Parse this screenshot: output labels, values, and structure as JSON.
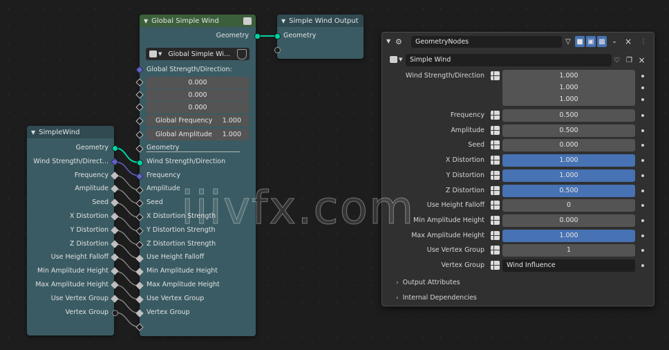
{
  "nodes": {
    "global_simple_wind": {
      "title": "Global Simple Wind",
      "output_geometry": "Geometry",
      "group_selector": "Global Simple Wi...",
      "strength_label": "Global Strength/Direction:",
      "strength_values": [
        "0.000",
        "0.000",
        "0.000"
      ],
      "frequency_label": "Global Frequency",
      "frequency_value": "1.000",
      "amplitude_label": "Global Amplitude",
      "amplitude_value": "1.000",
      "inputs": [
        "Geometry",
        "Wind Strength/Direction",
        "Frequency",
        "Amplitude",
        "Seed",
        "X Distortion Strength",
        "Y Distortion Strength",
        "Z Distortion Strength",
        "Use Height Falloff",
        "Min Amplitude Height",
        "Max Amplitude Height",
        "Use Vertex Group",
        "Vertex Group"
      ]
    },
    "simple_wind_output": {
      "title": "Simple Wind Output",
      "input_geometry": "Geometry"
    },
    "simple_wind": {
      "title": "SimpleWind",
      "outputs": [
        "Geometry",
        "Wind Strength/Direct...",
        "Frequency",
        "Amplitude",
        "Seed",
        "X Distortion",
        "Y Distortion",
        "Z Distortion",
        "Use Height Falloff",
        "Min Amplitude Height",
        "Max Amplitude Height",
        "Use Vertex Group",
        "Vertex Group"
      ]
    }
  },
  "panel": {
    "modifier_name": "GeometryNodes",
    "node_group": "Simple Wind",
    "properties": [
      {
        "label": "Wind Strength/Direction",
        "values": [
          "1.000",
          "1.000",
          "1.000"
        ],
        "style": "stack"
      },
      {
        "label": "Frequency",
        "value": "0.500",
        "style": "normal"
      },
      {
        "label": "Amplitude",
        "value": "0.500",
        "style": "normal"
      },
      {
        "label": "Seed",
        "value": "0.000",
        "style": "normal"
      },
      {
        "label": "X Distortion",
        "value": "1.000",
        "style": "blue"
      },
      {
        "label": "Y Distortion",
        "value": "1.000",
        "style": "blue"
      },
      {
        "label": "Z Distortion",
        "value": "0.500",
        "style": "blue"
      },
      {
        "label": "Use Height Falloff",
        "value": "0",
        "style": "normal"
      },
      {
        "label": "Min Amplitude Height",
        "value": "0.000",
        "style": "normal"
      },
      {
        "label": "Max Amplitude Height",
        "value": "1.000",
        "style": "blue"
      },
      {
        "label": "Use Vertex Group",
        "value": "1",
        "style": "normal"
      },
      {
        "label": "Vertex Group",
        "value": "Wind Influence",
        "style": "dark"
      }
    ],
    "sections": [
      "Output Attributes",
      "Internal Dependencies"
    ]
  },
  "watermark": "iiivfx.com",
  "colors": {
    "node_body": "#3a5b63",
    "group_header": "#3b5f3b",
    "geometry_socket": "#00d6a3",
    "vector_socket": "#6464c8",
    "slider_blue": "#4772b3"
  },
  "icons": [
    "node-tree-icon",
    "wrench-nodes-icon",
    "shield-icon",
    "filter-icon",
    "realtime-icon",
    "editmode-icon",
    "render-icon",
    "chevron-down-icon",
    "close-icon",
    "duplicate-icon",
    "vertex-group-toggle-icon"
  ]
}
